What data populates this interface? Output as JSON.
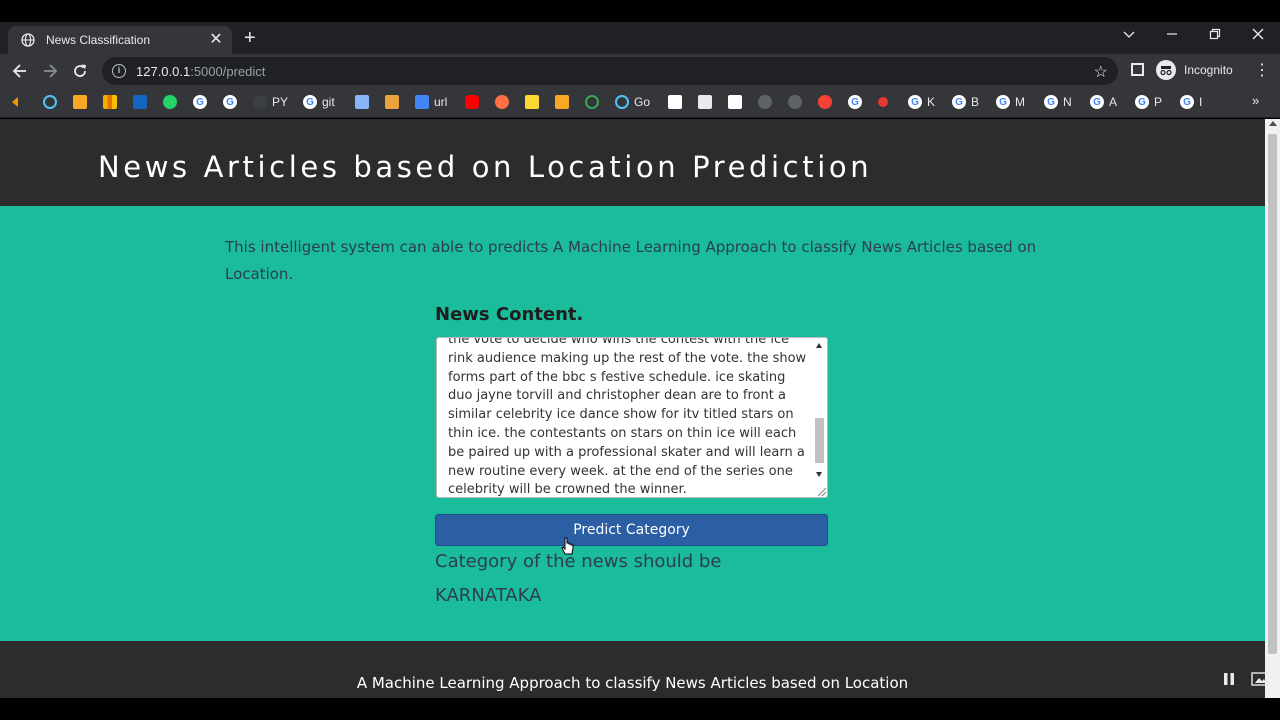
{
  "browser": {
    "tab_title": "News Classification",
    "tab_close": "✕",
    "new_tab": "+",
    "url_host": "127.0.0.1",
    "url_path": ":5000/predict",
    "profile_label": "Incognito",
    "bookmarks": [
      {
        "label": "PY"
      },
      {
        "label": "git"
      },
      {
        "label": "url"
      },
      {
        "label": "Go"
      },
      {
        "label": "K"
      },
      {
        "label": "B"
      },
      {
        "label": "M"
      },
      {
        "label": "N"
      },
      {
        "label": "A"
      },
      {
        "label": "P"
      },
      {
        "label": "I"
      }
    ]
  },
  "page": {
    "header_title": "News Articles based on Location Prediction",
    "intro_text": "This intelligent system can able to predicts A Machine Learning Approach to classify News Articles based on Location.",
    "content_label": "News Content.",
    "news_content": "the vote to decide who wins the contest  with the ice rink audience making up the rest of the vote. the show forms part of the bbc s festive schedule. ice skating duo jayne torvill and christopher dean are to front a similar celebrity ice dance show for itv  titled stars on thin ice. the contestants on stars on thin ice will each be paired up with a professional skater and will learn a new routine every week. at the end of the series  one celebrity will be crowned the winner.",
    "predict_button": "Predict Category",
    "result_prefix": "Category of the news should be",
    "result_value": "KARNATAKA",
    "footer_text": "A Machine Learning Approach to classify News Articles based on Location"
  },
  "colors": {
    "accent_teal": "#1abc9c",
    "header_dark": "#2c2c2c",
    "button_blue": "#2c5ea3"
  }
}
